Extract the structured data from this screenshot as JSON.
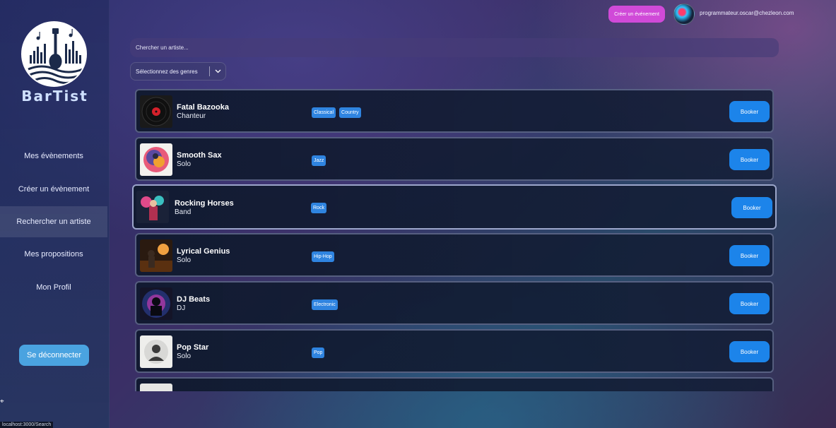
{
  "app": {
    "name": "BarTist",
    "logo": "guitar-soundwave-logo"
  },
  "sidebar": {
    "items": [
      {
        "label": "Mes évènements",
        "active": false
      },
      {
        "label": "Créer un évènement",
        "active": false
      },
      {
        "label": "Rechercher un artiste",
        "active": true
      },
      {
        "label": "Mes propositions",
        "active": false
      },
      {
        "label": "Mon Profil",
        "active": false
      }
    ],
    "logout_label": "Se déconnecter"
  },
  "header": {
    "create_label": "Créer un événement",
    "user_email": "programmateur.oscar@chezleon.com"
  },
  "search": {
    "placeholder": "Chercher un artiste..."
  },
  "genre_filter": {
    "label": "Sélectionnez des genres"
  },
  "artists": [
    {
      "name": "Fatal Bazooka",
      "kind": "Chanteur",
      "tags": [
        "Classical",
        "Country"
      ],
      "book_label": "Booker"
    },
    {
      "name": "Smooth Sax",
      "kind": "Solo",
      "tags": [
        "Jazz"
      ],
      "book_label": "Booker"
    },
    {
      "name": "Rocking Horses",
      "kind": "Band",
      "tags": [
        "Rock"
      ],
      "book_label": "Booker"
    },
    {
      "name": "Lyrical Genius",
      "kind": "Solo",
      "tags": [
        "Hip-Hop"
      ],
      "book_label": "Booker"
    },
    {
      "name": "DJ Beats",
      "kind": "DJ",
      "tags": [
        "Electronic"
      ],
      "book_label": "Booker"
    },
    {
      "name": "Pop Star",
      "kind": "Solo",
      "tags": [
        "Pop"
      ],
      "book_label": "Booker"
    }
  ],
  "status_bar": {
    "url": "localhost:3000/Search"
  },
  "colors": {
    "accent": "#1c84ea",
    "create_button": "#d04ad8",
    "logout_button": "#4aa3e0",
    "tag": "#2f84e0"
  }
}
